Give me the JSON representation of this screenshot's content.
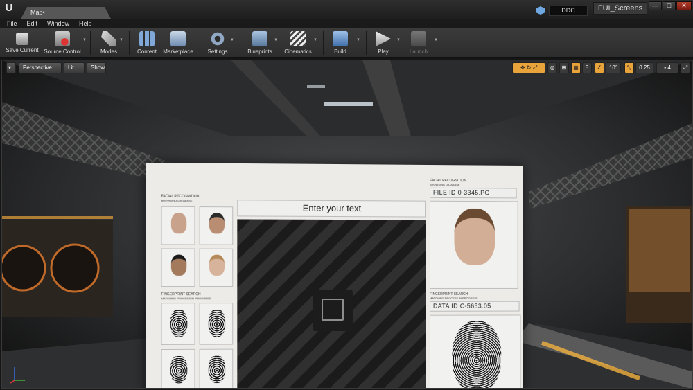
{
  "titlebar": {
    "tab_label": "Map•",
    "ddc_label": "DDC",
    "project_name": "FUI_Screens",
    "window_buttons": {
      "minimize": "—",
      "maximize": "□",
      "close": "✕"
    }
  },
  "menu": {
    "items": [
      "File",
      "Edit",
      "Window",
      "Help"
    ]
  },
  "toolbar": {
    "save_current": "Save Current",
    "source_control": "Source Control",
    "modes": "Modes",
    "content": "Content",
    "marketplace": "Marketplace",
    "settings": "Settings",
    "blueprints": "Blueprints",
    "cinematics": "Cinematics",
    "build": "Build",
    "play": "Play",
    "launch": "Launch"
  },
  "viewport": {
    "perspective": "Perspective",
    "lit": "Lit",
    "show": "Show",
    "grid_snap": "5",
    "rotation_snap": "10°",
    "scale_snap": "0.25",
    "camera_speed": "4"
  },
  "screen": {
    "left_facial_title": "FACIAL RECOGNITION",
    "left_facial_sub": "BROWSING DATABASE",
    "left_fingerprint_title": "FINGERPRINT SEARCH",
    "left_fingerprint_sub": "MATCHING PROCESS IN PROGRESS",
    "center_text": "Enter your text",
    "right_facial_title": "FACIAL RECOGNITION",
    "right_facial_sub": "BROWSING DATABASE",
    "file_id": "FILE ID 0-3345.PC",
    "right_fingerprint_title": "FINGERPRINT SEARCH",
    "right_fingerprint_sub": "MATCHING PROCESS IN PROGRESS",
    "data_id": "DATA ID C-5653.05"
  },
  "colors": {
    "viewport_highlight": "#e8a33b",
    "accent_blue": "#6fa7e0",
    "panel_bg": "#ecebe8",
    "stripe_dark": "#1b1b1b"
  }
}
